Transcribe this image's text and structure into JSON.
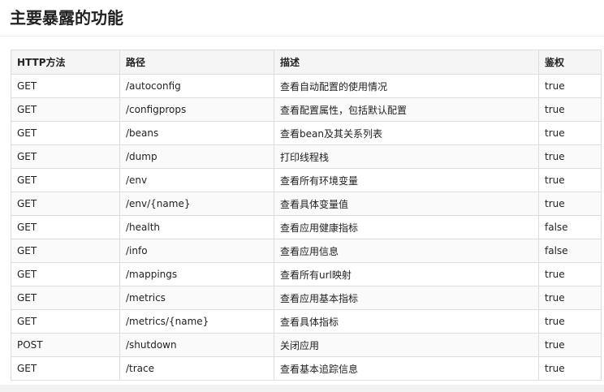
{
  "page": {
    "title": "主要暴露的功能"
  },
  "table": {
    "headers": {
      "method": "HTTP方法",
      "path": "路径",
      "description": "描述",
      "auth": "鉴权"
    },
    "rows": [
      {
        "method": "GET",
        "path": "/autoconfig",
        "description": "查看自动配置的使用情况",
        "auth": "true"
      },
      {
        "method": "GET",
        "path": "/configprops",
        "description": "查看配置属性，包括默认配置",
        "auth": "true"
      },
      {
        "method": "GET",
        "path": "/beans",
        "description": "查看bean及其关系列表",
        "auth": "true"
      },
      {
        "method": "GET",
        "path": "/dump",
        "description": "打印线程栈",
        "auth": "true"
      },
      {
        "method": "GET",
        "path": "/env",
        "description": "查看所有环境变量",
        "auth": "true"
      },
      {
        "method": "GET",
        "path": "/env/{name}",
        "description": "查看具体变量值",
        "auth": "true"
      },
      {
        "method": "GET",
        "path": "/health",
        "description": "查看应用健康指标",
        "auth": "false"
      },
      {
        "method": "GET",
        "path": "/info",
        "description": "查看应用信息",
        "auth": "false"
      },
      {
        "method": "GET",
        "path": "/mappings",
        "description": "查看所有url映射",
        "auth": "true"
      },
      {
        "method": "GET",
        "path": "/metrics",
        "description": "查看应用基本指标",
        "auth": "true"
      },
      {
        "method": "GET",
        "path": "/metrics/{name}",
        "description": "查看具体指标",
        "auth": "true"
      },
      {
        "method": "POST",
        "path": "/shutdown",
        "description": "关闭应用",
        "auth": "true"
      },
      {
        "method": "GET",
        "path": "/trace",
        "description": "查看基本追踪信息",
        "auth": "true"
      }
    ]
  }
}
